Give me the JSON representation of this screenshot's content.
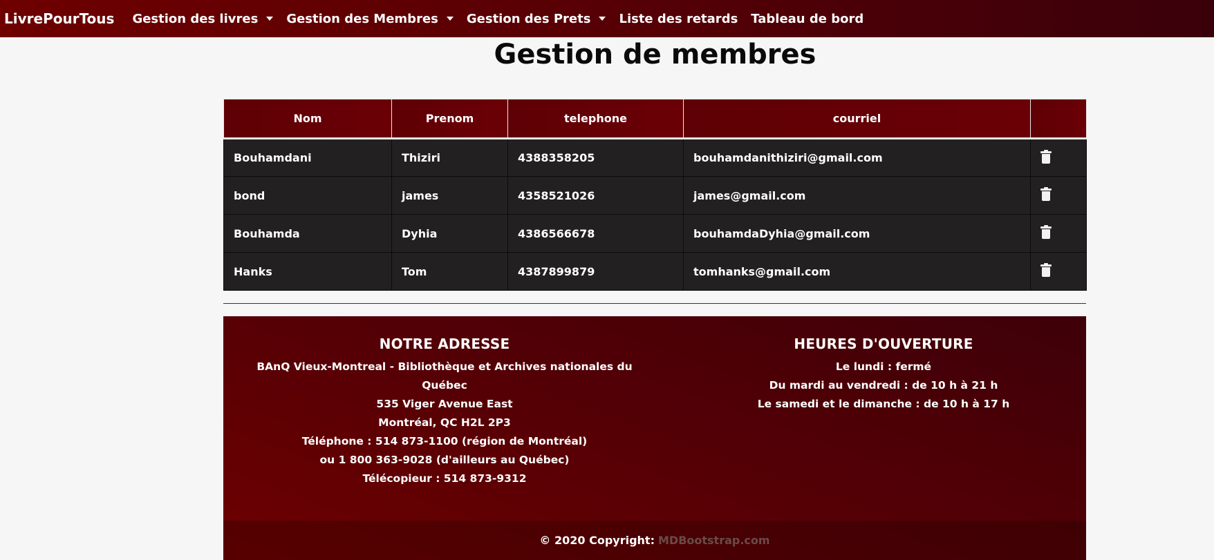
{
  "navbar": {
    "brand": "LivrePourTous",
    "items": [
      {
        "label": "Gestion des livres",
        "dropdown": true
      },
      {
        "label": "Gestion des Membres",
        "dropdown": true
      },
      {
        "label": "Gestion des Prets",
        "dropdown": true
      },
      {
        "label": "Liste des retards",
        "dropdown": false
      },
      {
        "label": "Tableau de bord",
        "dropdown": false
      }
    ]
  },
  "page_title": "Gestion de membres",
  "table": {
    "headers": [
      "Nom",
      "Prenom",
      "telephone",
      "courriel",
      ""
    ],
    "rows": [
      {
        "nom": "Bouhamdani",
        "prenom": "Thiziri",
        "telephone": "4388358205",
        "courriel": "bouhamdanithiziri@gmail.com"
      },
      {
        "nom": "bond",
        "prenom": "james",
        "telephone": "4358521026",
        "courriel": "james@gmail.com"
      },
      {
        "nom": "Bouhamda",
        "prenom": "Dyhia",
        "telephone": "4386566678",
        "courriel": "bouhamdaDyhia@gmail.com"
      },
      {
        "nom": "Hanks",
        "prenom": "Tom",
        "telephone": "4387899879",
        "courriel": "tomhanks@gmail.com"
      }
    ],
    "action_icon": "trash-icon"
  },
  "footer": {
    "address": {
      "title": "NOTRE ADRESSE",
      "lines": [
        "BAnQ Vieux-Montreal - Bibliothèque et Archives nationales du",
        "Québec",
        "535 Viger Avenue East",
        "Montréal, QC H2L 2P3",
        "Téléphone : 514 873-1100 (région de Montréal)",
        "ou 1 800 363-9028 (d'ailleurs au Québec)",
        "Télécopieur : 514 873-9312"
      ]
    },
    "hours": {
      "title": "HEURES D'OUVERTURE",
      "lines": [
        "Le lundi : fermé",
        "Du mardi au vendredi : de 10 h à 21 h",
        "Le samedi et le dimanche : de 10 h à 17 h"
      ]
    },
    "copyright_prefix": "© 2020 Copyright:",
    "copyright_link": "MDBootstrap.com"
  },
  "colors": {
    "primary_dark_red": "#5e0005",
    "table_row_bg": "#232021",
    "page_bg": "#f6f6f6"
  }
}
